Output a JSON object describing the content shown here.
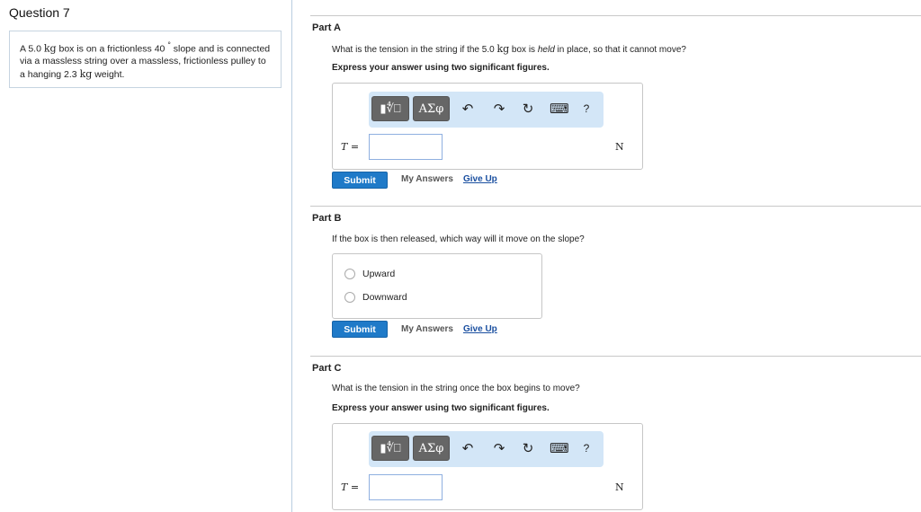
{
  "question": {
    "title": "Question 7",
    "text_parts": [
      "A 5.0 ",
      "kg",
      " box is on a frictionless 40 ",
      "°",
      "  slope and is connected via a massless string over a massless, frictionless pulley to a hanging 2.3 ",
      "kg",
      " weight."
    ]
  },
  "toolbar": {
    "templates": "▮∜⎕",
    "symbols": "ΑΣφ",
    "undo": "↶",
    "redo": "↷",
    "reset": "↻",
    "keyboard": "⌨",
    "help": "?"
  },
  "partA": {
    "label": "Part A",
    "question_pre": "What is the tension in the string if the 5.0 ",
    "unit_kg": "kg",
    "question_mid": " box is ",
    "held": "held",
    "question_post": " in place, so that it cannot move?",
    "instruction": "Express your answer using two significant figures.",
    "var": "T =",
    "unit": "N",
    "value": ""
  },
  "partB": {
    "label": "Part B",
    "question": "If the box is then released, which way will it move on the slope?",
    "options": [
      "Upward",
      "Downward"
    ]
  },
  "partC": {
    "label": "Part C",
    "question": "What is the tension in the string once the box begins to move?",
    "instruction": "Express your answer using two significant figures.",
    "var": "T =",
    "unit": "N",
    "value": ""
  },
  "actions": {
    "submit": "Submit",
    "my_answers": "My Answers",
    "give_up": "Give Up"
  }
}
